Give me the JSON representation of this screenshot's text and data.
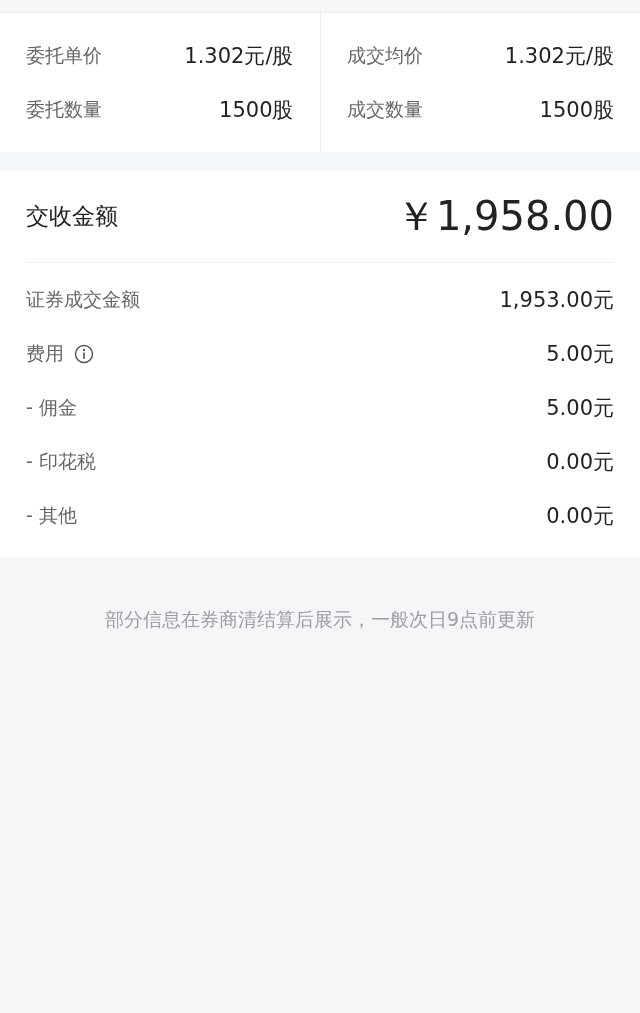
{
  "order_columns": [
    {
      "rows": [
        {
          "label": "委托单价",
          "value": "1.302元/股"
        },
        {
          "label": "委托数量",
          "value": "1500股"
        }
      ]
    },
    {
      "rows": [
        {
          "label": "成交均价",
          "value": "1.302元/股"
        },
        {
          "label": "成交数量",
          "value": "1500股"
        }
      ]
    }
  ],
  "settlement": {
    "label": "交收金额",
    "amount": "￥1,958.00"
  },
  "details": [
    {
      "kind": "plain",
      "label": "证券成交金额",
      "value": "1,953.00元"
    },
    {
      "kind": "info",
      "label": "费用",
      "value": "5.00元"
    },
    {
      "kind": "plain",
      "label": "- 佣金",
      "value": "5.00元"
    },
    {
      "kind": "plain",
      "label": "- 印花税",
      "value": "0.00元"
    },
    {
      "kind": "plain",
      "label": "- 其他",
      "value": "0.00元"
    }
  ],
  "footnote": "部分信息在券商清结算后展示，一般次日9点前更新"
}
